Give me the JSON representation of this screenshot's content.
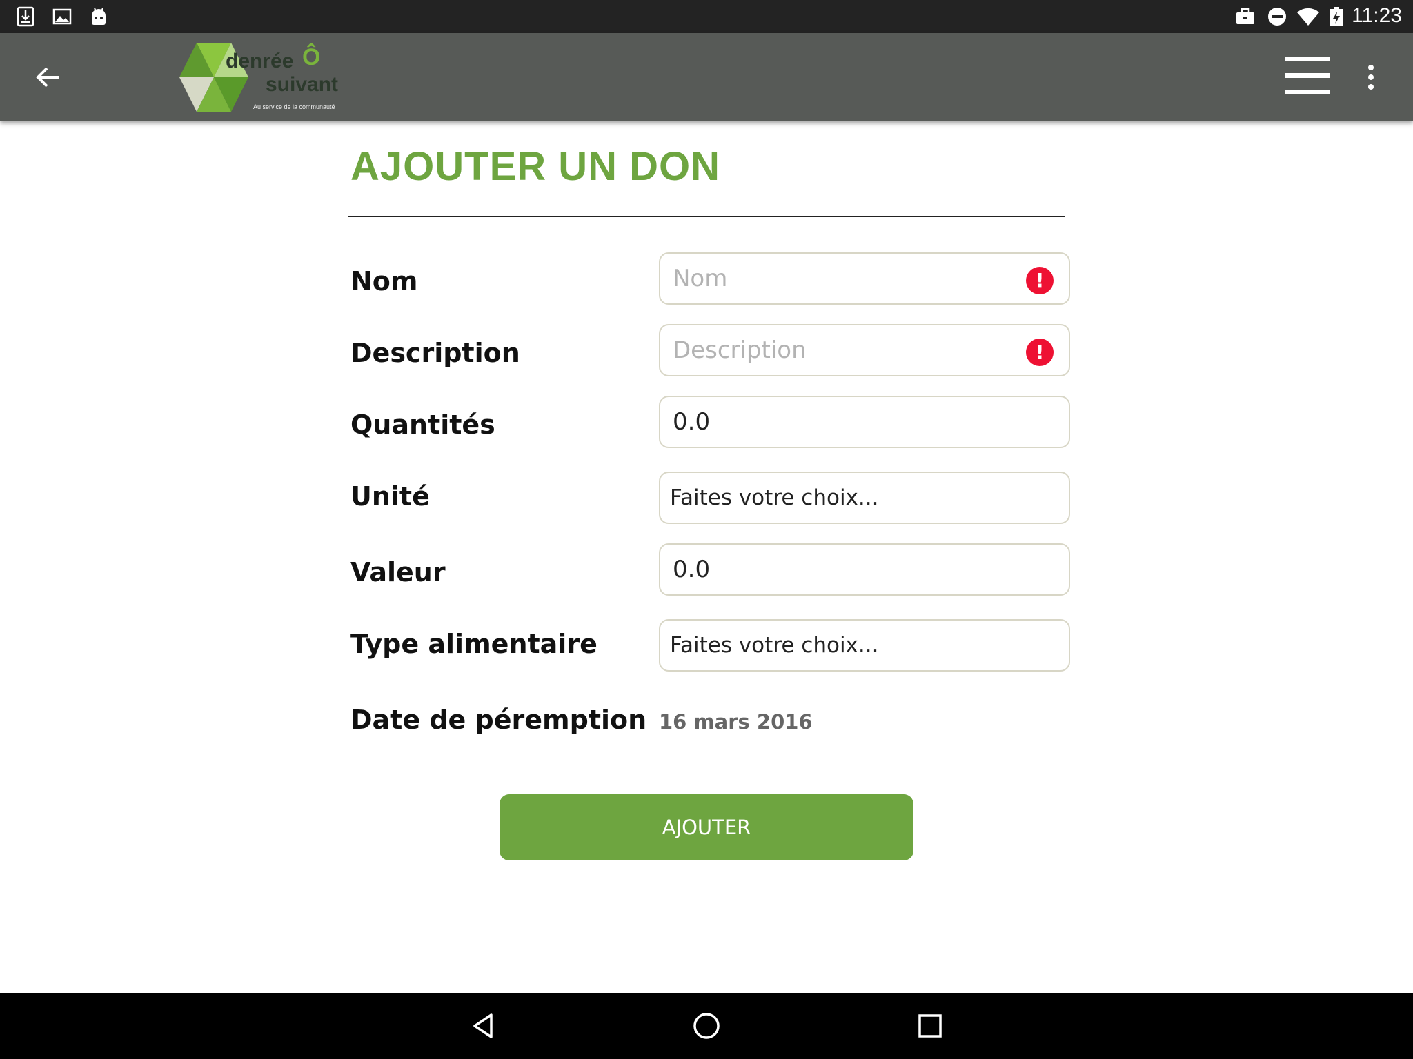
{
  "status_bar": {
    "time": "11:23",
    "icons": [
      "download-icon",
      "image-icon",
      "android-icon",
      "briefcase-icon",
      "do-not-disturb-icon",
      "wifi-icon",
      "battery-charging-icon"
    ]
  },
  "app_bar": {
    "logo_text_1": "denrée",
    "logo_text_o": "Ô",
    "logo_text_2": "suivant",
    "logo_tagline": "Au service de la communauté",
    "icons": [
      "back-arrow-icon",
      "menu-icon",
      "more-vert-icon"
    ]
  },
  "form": {
    "title": "AJOUTER UN DON",
    "fields": {
      "nom": {
        "label": "Nom",
        "placeholder": "Nom",
        "value": "",
        "error": "!"
      },
      "description": {
        "label": "Description",
        "placeholder": "Description",
        "value": "",
        "error": "!"
      },
      "quantites": {
        "label": "Quantités",
        "value": "0.0"
      },
      "unite": {
        "label": "Unité",
        "selected": "Faites votre choix..."
      },
      "valeur": {
        "label": "Valeur",
        "value": "0.0"
      },
      "type_alimentaire": {
        "label": "Type alimentaire",
        "selected": "Faites votre choix..."
      },
      "date_peremption": {
        "label": "Date de péremption",
        "value": "16 mars 2016"
      }
    },
    "submit_label": "AJOUTER"
  },
  "colors": {
    "accent_green": "#6ea540",
    "app_bar": "#575a57",
    "status_bar": "#232323",
    "error_red": "#ee1133"
  },
  "nav_bar": {
    "icons": [
      "nav-back-icon",
      "nav-home-icon",
      "nav-recents-icon"
    ]
  }
}
